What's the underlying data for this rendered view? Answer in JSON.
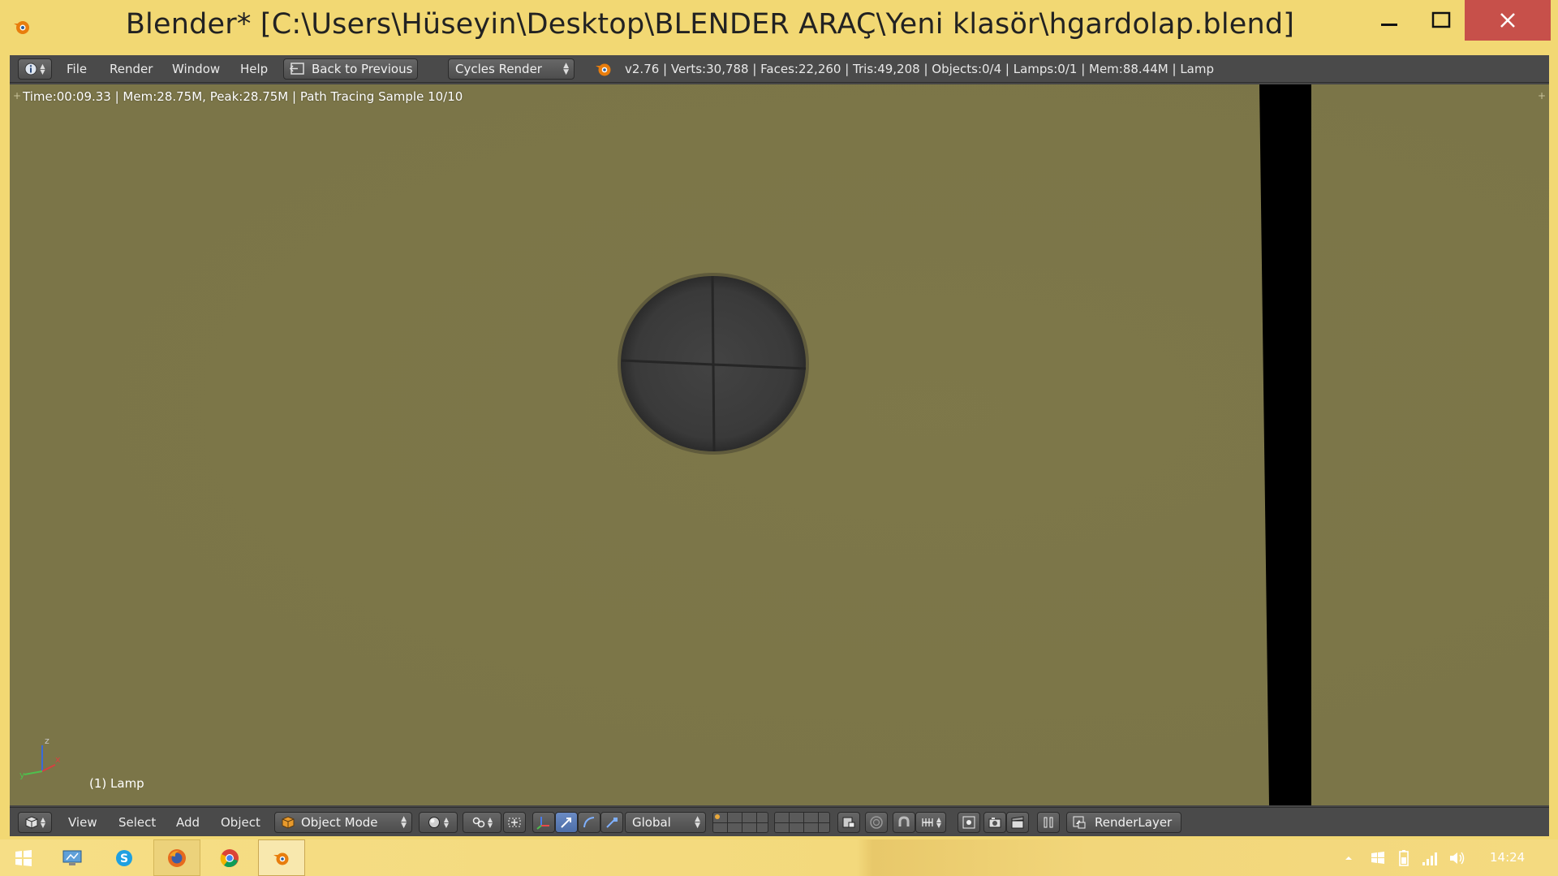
{
  "window": {
    "title": "Blender* [C:\\Users\\Hüseyin\\Desktop\\BLENDER ARAÇ\\Yeni klasör\\hgardolap.blend]",
    "app_icon": "blender-icon",
    "controls": [
      "minimize-icon",
      "maximize-icon",
      "close-icon"
    ]
  },
  "info_header": {
    "editor_type_icon": "info-icon",
    "menus": [
      "File",
      "Render",
      "Window",
      "Help"
    ],
    "back_button": "Back to Previous",
    "render_engine": "Cycles Render",
    "stats": "v2.76 | Verts:30,788 | Faces:22,260 | Tris:49,208 | Objects:0/4 | Lamps:0/1 | Mem:88.44M | Lamp"
  },
  "viewport": {
    "render_info": "Time:00:09.33 | Mem:28.75M, Peak:28.75M | Path Tracing Sample 10/10",
    "object_label": "(1) Lamp",
    "axis_labels": {
      "z": "z",
      "x": "x",
      "y": "y"
    },
    "colors": {
      "wall": "#7b7548",
      "hole": "#3a3a3a",
      "beam": "#000000"
    }
  },
  "view3d_header": {
    "editor_type_icon": "3d-view-icon",
    "menus": [
      "View",
      "Select",
      "Add",
      "Object"
    ],
    "mode": "Object Mode",
    "pivot_icon": "pivot-icon",
    "orientation": "Global",
    "render_layer": "RenderLayer"
  },
  "taskbar": {
    "apps": [
      "windows-start-icon",
      "remote-desktop-icon",
      "skype-icon",
      "firefox-icon",
      "chrome-icon",
      "blender-icon"
    ],
    "time": "14:24"
  }
}
